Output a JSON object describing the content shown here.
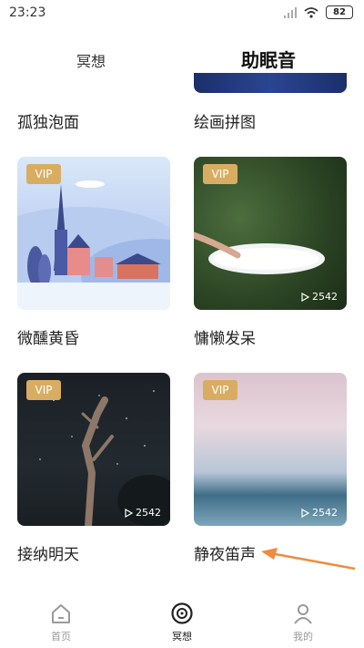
{
  "status": {
    "time": "23:23",
    "battery": "82"
  },
  "tabs": {
    "meditation": "冥想",
    "sleep_sounds": "助眠音"
  },
  "row0": {
    "left_title": "孤独泡面",
    "right_title": "绘画拼图"
  },
  "cards": [
    {
      "title": "微醺黄昏",
      "vip": "VIP"
    },
    {
      "title": "慵懒发呆",
      "vip": "VIP",
      "plays": "2542"
    },
    {
      "title": "接纳明天",
      "vip": "VIP",
      "plays": "2542"
    },
    {
      "title": "静夜笛声",
      "vip": "VIP",
      "plays": "2542"
    }
  ],
  "nav": {
    "home": "首页",
    "meditation": "冥想",
    "mine": "我的"
  },
  "colors": {
    "accent_tab": "#2a3d7a",
    "vip_badge": "#d8ad62",
    "arrow": "#f08a3c"
  }
}
